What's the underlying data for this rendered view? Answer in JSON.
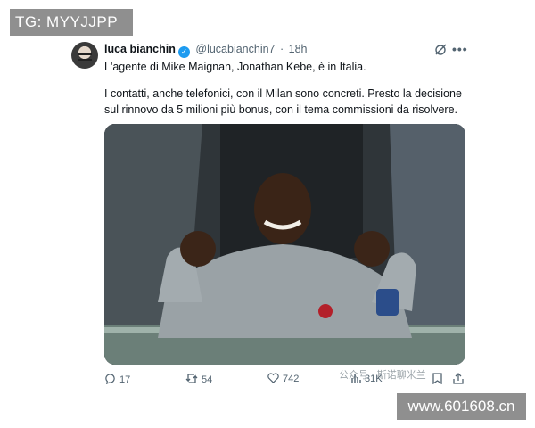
{
  "overlay": {
    "tg_label": "TG: MYYJJPP",
    "site_label": "www.601608.cn",
    "watermark": "公众号 · 斯诺聊米兰"
  },
  "tweet": {
    "author_name": "luca bianchin",
    "verified_mark": "✓",
    "handle": "@lucabianchin7",
    "separator": "·",
    "time": "18h",
    "text_line1": "L'agente di Mike Maignan, Jonathan Kebe, è in Italia.",
    "text_line2": "I contatti, anche telefonici, con il Milan sono concreti. Presto la decisione",
    "text_line3": "sul rinnovo da 5 milioni più bonus, con il tema commissioni da risolvere.",
    "more": "•••"
  },
  "actions": {
    "replies": "17",
    "reposts": "54",
    "likes": "742",
    "views": "31K"
  },
  "icons": {
    "reply": "reply-icon",
    "repost": "repost-icon",
    "like": "heart-icon",
    "views": "chart-icon",
    "bookmark": "bookmark-icon",
    "share": "share-icon",
    "grok": "grok-icon",
    "verified": "verified-badge-icon"
  },
  "colors": {
    "accent": "#1d9bf0",
    "text": "#0f1419",
    "muted": "#536471"
  }
}
